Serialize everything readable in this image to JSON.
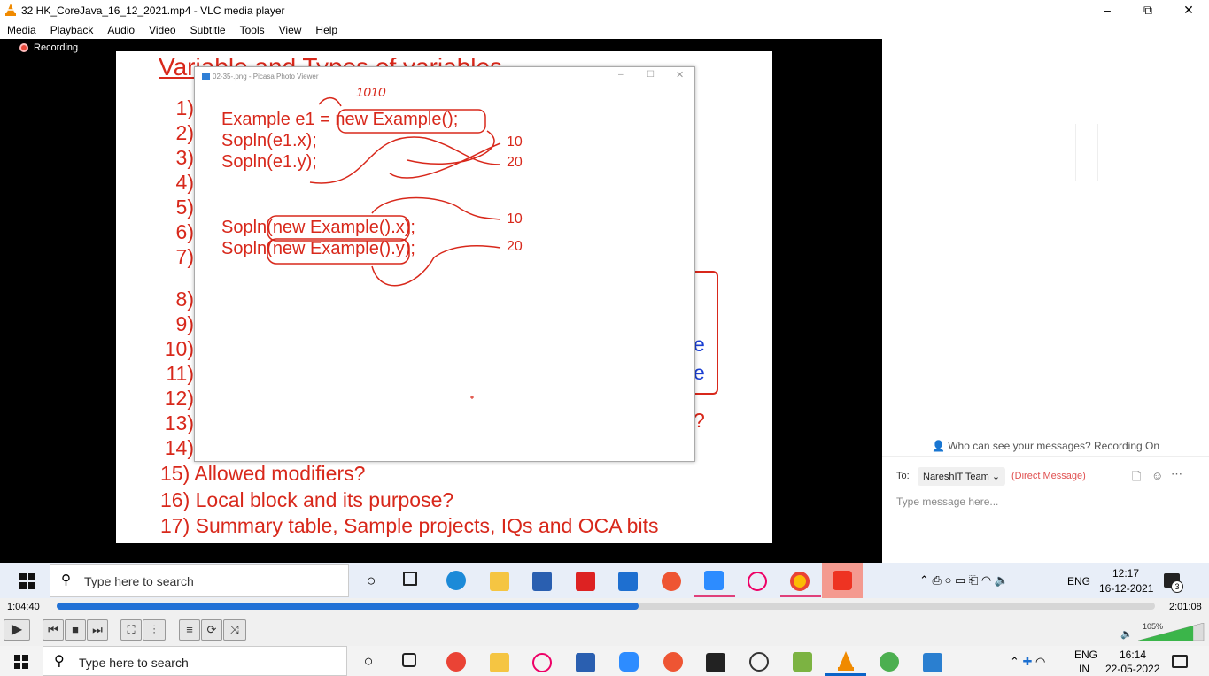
{
  "window": {
    "title": "32 HK_CoreJava_16_12_2021.mp4 - VLC media player",
    "minimize": "–",
    "maximize": "⧉",
    "close": "✕"
  },
  "menu": [
    "Media",
    "Playback",
    "Audio",
    "Video",
    "Subtitle",
    "Tools",
    "View",
    "Help"
  ],
  "video": {
    "recording_label": "Recording",
    "slide": {
      "title": "Variable and Types of variables",
      "numbers": [
        "1)",
        "2)",
        "3)",
        "4)",
        "5)",
        "6)",
        "7)",
        "",
        "8)",
        "9)",
        "10)",
        "11)",
        "12)",
        "13)",
        "14)"
      ],
      "line15": "15) Allowed modifiers?",
      "line16": "16) Local block and its purpose?",
      "line17": "17) Summary table, Sample projects, IQs and OCA bits",
      "frag_e1": "e",
      "frag_e2": "e",
      "frag_q": "?"
    },
    "picasa": {
      "title": "02-35-.png - Picasa Photo Viewer",
      "code1": "Example e1 = new Example();",
      "code2": "Sopln(e1.x);",
      "code3": "Sopln(e1.y);",
      "code4": "Sopln(new Example().x);",
      "code5": "Sopln(new Example().y);",
      "note_1010": "1010",
      "note_10a": "10",
      "note_20a": "20",
      "note_10b": "10",
      "note_20b": "20"
    },
    "chat": {
      "visibility": "Who can see your messages? Recording On",
      "to_label": "To:",
      "recipient": "NareshIT Team ⌄",
      "direct": "(Direct Message)",
      "placeholder": "Type message here..."
    },
    "inner_taskbar": {
      "search": "Type here to search",
      "lang": "ENG",
      "time": "12:17",
      "date": "16-12-2021",
      "notif_count": "3"
    }
  },
  "player": {
    "elapsed": "1:04:40",
    "total": "2:01:08",
    "progress": 0.53,
    "volume": "105%"
  },
  "taskbar": {
    "search": "Type here to search",
    "lang_top": "ENG",
    "lang_bottom": "IN",
    "time": "16:14",
    "date": "22-05-2022"
  }
}
